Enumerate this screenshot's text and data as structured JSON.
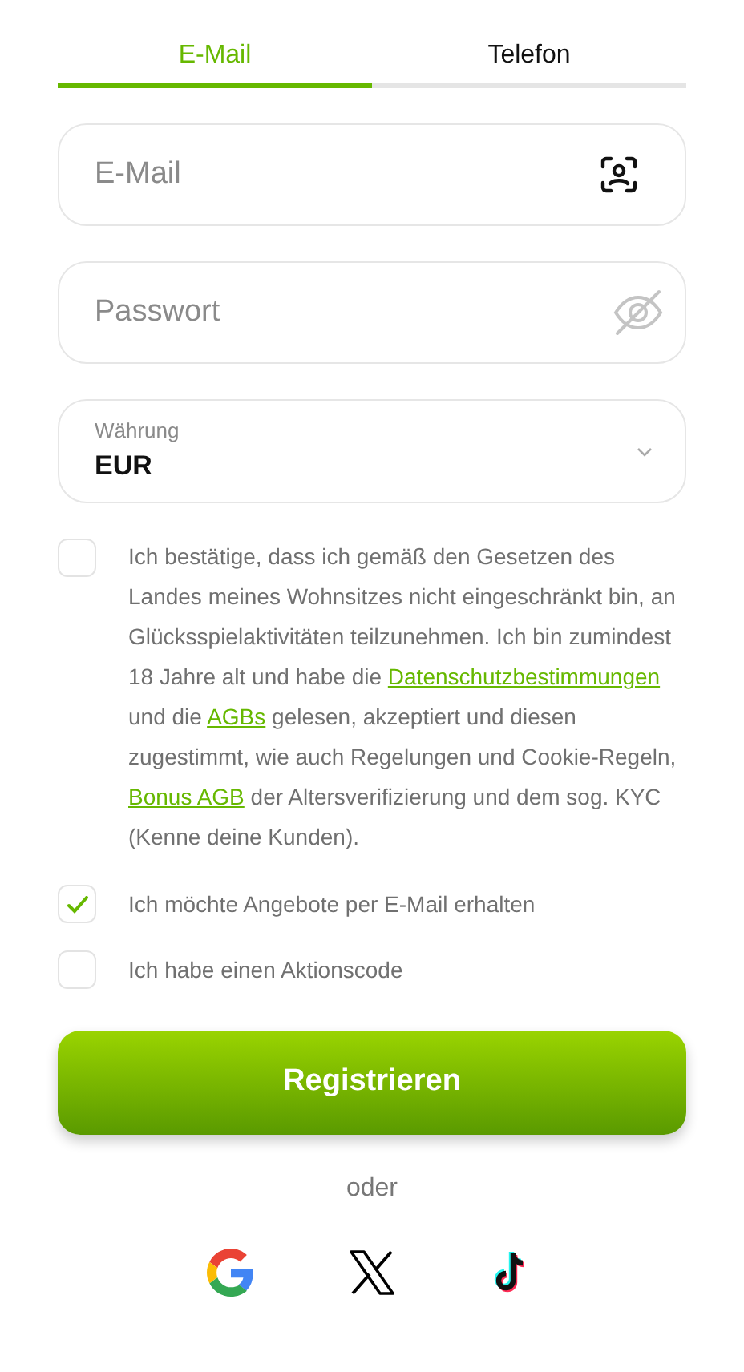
{
  "tabs": [
    {
      "label": "E-Mail",
      "selected": true
    },
    {
      "label": "Telefon",
      "selected": false
    }
  ],
  "email_field": {
    "placeholder": "E-Mail"
  },
  "password_field": {
    "placeholder": "Passwort"
  },
  "currency_select": {
    "label": "Währung",
    "value": "EUR"
  },
  "checkboxes": [
    {
      "checked": false,
      "kind": "consent",
      "parts": [
        {
          "kind": "text",
          "text": "Ich bestätige, dass ich gemäß den Gesetzen des Landes meines Wohnsitzes nicht eingeschränkt bin, an Glücksspielaktivitäten teilzunehmen. Ich bin zumindest 18 Jahre alt und habe die "
        },
        {
          "kind": "link",
          "text": "Datenschutzbestimmungen"
        },
        {
          "kind": "text",
          "text": " und die "
        },
        {
          "kind": "link",
          "text": "AGBs"
        },
        {
          "kind": "text",
          "text": " gelesen, akzeptiert und diesen zugestimmt, wie auch Regelungen und Cookie-Regeln, "
        },
        {
          "kind": "link",
          "text": "Bonus AGB"
        },
        {
          "kind": "text",
          "text": " der Altersverifizierung und dem sog. KYC (Kenne deine Kunden)."
        }
      ]
    },
    {
      "checked": true,
      "kind": "plain",
      "label": "Ich möchte Angebote per E-Mail erhalten"
    },
    {
      "checked": false,
      "kind": "plain",
      "label": "Ich habe einen Aktionscode"
    }
  ],
  "register_button": {
    "label": "Registrieren"
  },
  "separator": "oder",
  "social_logins": [
    {
      "kind": "google"
    },
    {
      "kind": "x"
    },
    {
      "kind": "tiktok"
    }
  ]
}
